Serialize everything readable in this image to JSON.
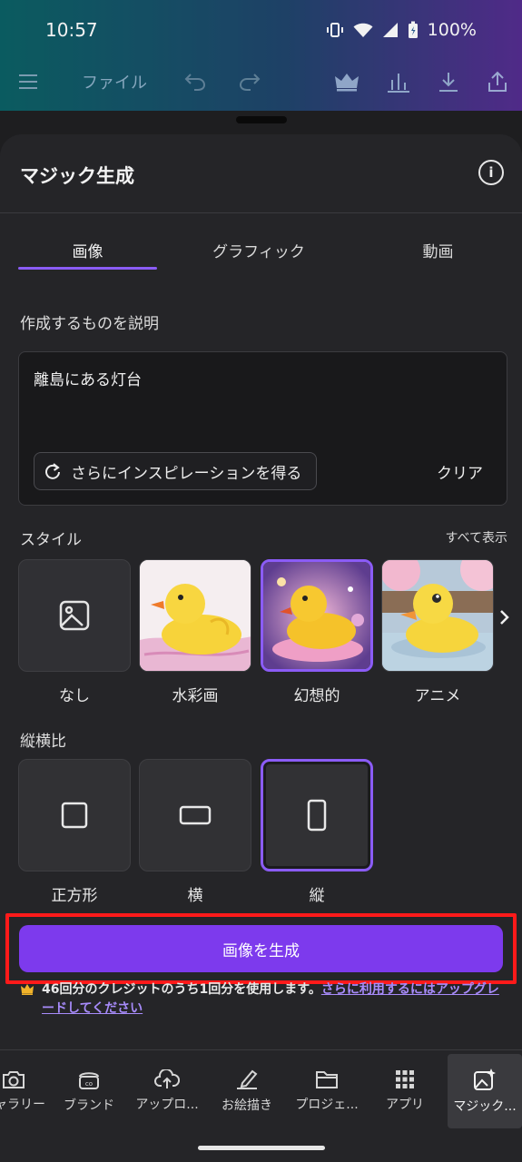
{
  "status": {
    "time": "10:57",
    "battery": "100%"
  },
  "appbar": {
    "file_label": "ファイル"
  },
  "sheet": {
    "title": "マジック生成",
    "tabs": [
      {
        "label": "画像"
      },
      {
        "label": "グラフィック"
      },
      {
        "label": "動画"
      }
    ],
    "prompt_label": "作成するものを説明",
    "prompt_value": "離島にある灯台",
    "inspire_label": "さらにインスピレーションを得る",
    "clear_label": "クリア",
    "style_label": "スタイル",
    "see_all_label": "すべて表示",
    "styles": [
      {
        "label": "なし"
      },
      {
        "label": "水彩画"
      },
      {
        "label": "幻想的"
      },
      {
        "label": "アニメ"
      }
    ],
    "selected_style": "幻想的",
    "ratio_label": "縦横比",
    "ratios": [
      {
        "label": "正方形"
      },
      {
        "label": "横"
      },
      {
        "label": "縦"
      }
    ],
    "selected_ratio": "縦",
    "generate_label": "画像を生成",
    "credit_text": "46回分のクレジットのうち1回分を使用します。",
    "credit_link": "さらに利用するにはアップグレードしてください"
  },
  "nav": [
    {
      "label": "ギャラリー"
    },
    {
      "label": "ブランド"
    },
    {
      "label": "アップロ..."
    },
    {
      "label": "お絵描き"
    },
    {
      "label": "プロジェ..."
    },
    {
      "label": "アプリ"
    },
    {
      "label": "マジック..."
    }
  ],
  "colors": {
    "accent": "#7d3aed",
    "highlight": "#ff1a1a",
    "sheet_bg": "#252528"
  }
}
